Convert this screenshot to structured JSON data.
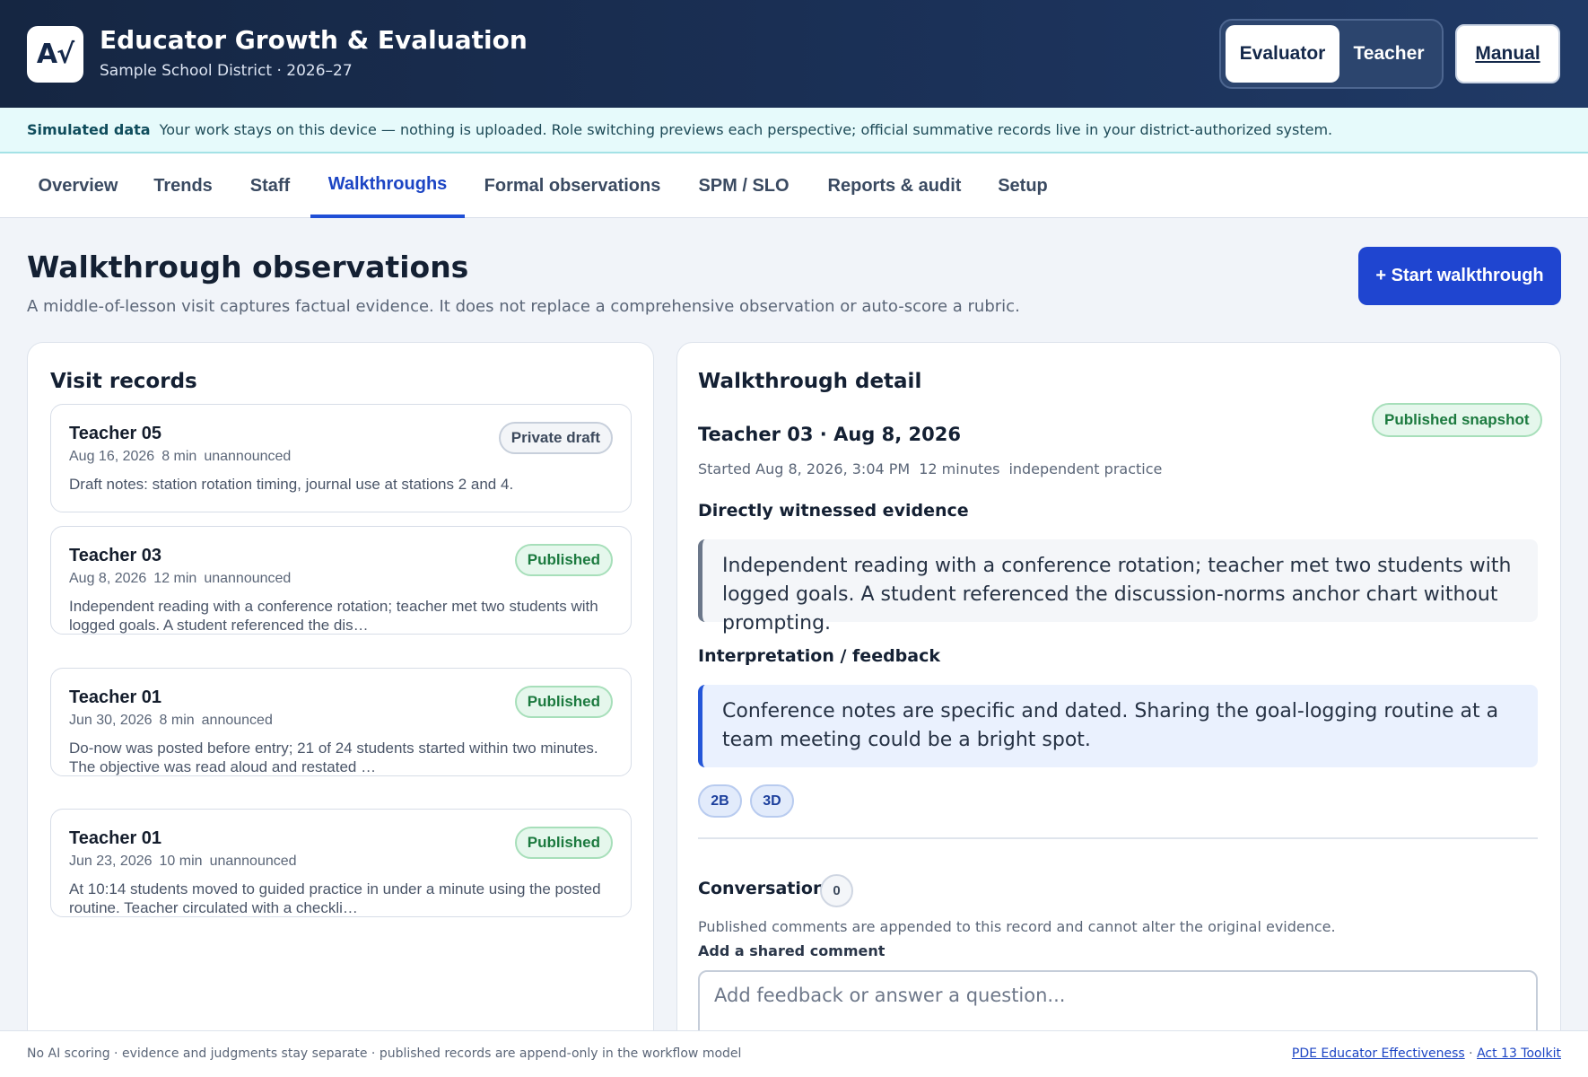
{
  "header": {
    "logo_text": "A√",
    "title": "Educator Growth & Evaluation",
    "subtitle": "Sample School District · 2026–27",
    "roles": [
      "Evaluator",
      "Teacher"
    ],
    "active_role": "Evaluator",
    "manual_label": "Manual"
  },
  "banner": {
    "label": "Simulated data",
    "text": "Your work stays on this device — nothing is uploaded. Role switching previews each perspective; official summative records live in your district-authorized system."
  },
  "tabs": [
    {
      "label": "Overview"
    },
    {
      "label": "Trends"
    },
    {
      "label": "Staff"
    },
    {
      "label": "Walkthroughs"
    },
    {
      "label": "Formal observations"
    },
    {
      "label": "SPM / SLO"
    },
    {
      "label": "Reports & audit"
    },
    {
      "label": "Setup"
    }
  ],
  "active_tab": "Walkthroughs",
  "page": {
    "title": "Walkthrough observations",
    "subtitle": "A middle-of-lesson visit captures factual evidence. It does not replace a comprehensive observation or auto-score a rubric.",
    "start_button": "+ Start walkthrough"
  },
  "visit_records": {
    "title": "Visit records",
    "items": [
      {
        "teacher": "Teacher 05",
        "date": "Aug 16, 2026",
        "duration": "8 min",
        "type": "unannounced",
        "status": "Private draft",
        "notes": "Draft notes: station rotation timing, journal use at stations 2 and 4."
      },
      {
        "teacher": "Teacher 03",
        "date": "Aug 8, 2026",
        "duration": "12 min",
        "type": "unannounced",
        "status": "Published",
        "notes": "Independent reading with a conference rotation; teacher met two students with logged goals. A student referenced the dis…"
      },
      {
        "teacher": "Teacher 01",
        "date": "Jun 30, 2026",
        "duration": "8 min",
        "type": "announced",
        "status": "Published",
        "notes": "Do-now was posted before entry; 21 of 24 students started within two minutes. The objective was read aloud and restated …"
      },
      {
        "teacher": "Teacher 01",
        "date": "Jun 23, 2026",
        "duration": "10 min",
        "type": "unannounced",
        "status": "Published",
        "notes": "At 10:14 students moved to guided practice in under a minute using the posted routine. Teacher circulated with a checkli…"
      }
    ]
  },
  "detail": {
    "title": "Walkthrough detail",
    "status": "Published snapshot",
    "heading": "Teacher 03 · Aug 8, 2026",
    "started": "Started Aug 8, 2026, 3:04 PM",
    "duration": "12 minutes",
    "context": "independent practice",
    "evidence_heading": "Directly witnessed evidence",
    "evidence": "Independent reading with a conference rotation; teacher met two students with logged goals. A student referenced the discussion-norms anchor chart without prompting.",
    "feedback_heading": "Interpretation / feedback",
    "feedback": "Conference notes are specific and dated. Sharing the goal-logging routine at a team meeting could be a bright spot.",
    "tags": [
      "2B",
      "3D"
    ],
    "conversation_heading": "Conversation",
    "conversation_count": "0",
    "conversation_note": "Published comments are appended to this record and cannot alter the original evidence.",
    "comment_label": "Add a shared comment",
    "comment_placeholder": "Add feedback or answer a question..."
  },
  "footer": {
    "note": "No AI scoring · evidence and judgments stay separate · published records are append-only in the workflow model",
    "link1": "PDE Educator Effectiveness",
    "separator": "·",
    "link2": "Act 13 Toolkit"
  },
  "colors": {
    "header_bg": "#152642",
    "accent": "#1f45d0",
    "published_green": "#1c7a3f",
    "banner_bg": "#e6fafb"
  }
}
